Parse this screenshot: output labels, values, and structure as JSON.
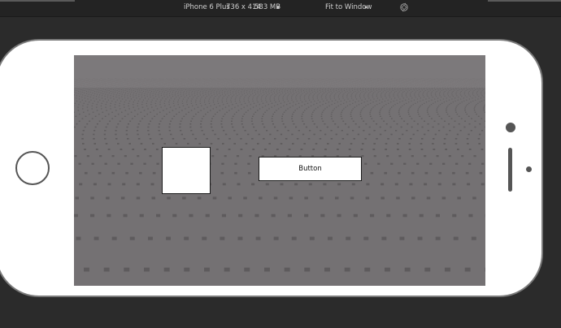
{
  "toolbar": {
    "device": "iPhone 6 Plus",
    "resolution": "736 x 414",
    "memory": "583 MB",
    "scale_mode": "Fit to Window",
    "rotate_icon": "rotate-icon"
  },
  "viewport": {
    "button_label": "Button",
    "baseplate_color": "#747173",
    "stud_color": "#5e5b5d"
  },
  "device_frame": {
    "bezel_color": "#ffffff",
    "outline_color": "#7a7a7a"
  }
}
